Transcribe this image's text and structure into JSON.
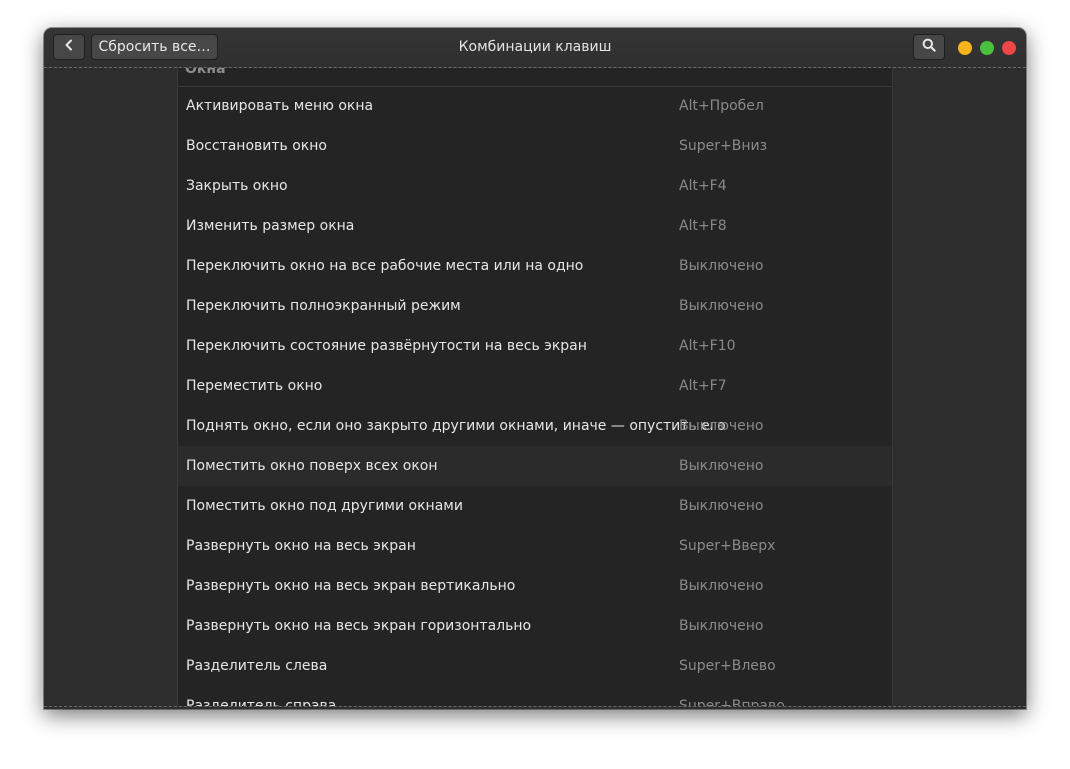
{
  "window": {
    "title": "Комбинации клавиш",
    "reset_label": "Сбросить все…"
  },
  "icons": {
    "back": "chevron-left-icon",
    "search": "search-icon",
    "minimize": "minimize-dot",
    "maximize": "maximize-dot",
    "close": "close-dot"
  },
  "colors": {
    "minimize": "#f5b41c",
    "maximize": "#4ac13e",
    "close": "#ed4646"
  },
  "section": {
    "title": "Окна",
    "rows": [
      {
        "label": "Активировать меню окна",
        "accel": "Alt+Пробел"
      },
      {
        "label": "Восстановить окно",
        "accel": "Super+Вниз"
      },
      {
        "label": "Закрыть окно",
        "accel": "Alt+F4"
      },
      {
        "label": "Изменить размер окна",
        "accel": "Alt+F8"
      },
      {
        "label": "Переключить окно на все рабочие места или на одно",
        "accel": "Выключено"
      },
      {
        "label": "Переключить полноэкранный режим",
        "accel": "Выключено"
      },
      {
        "label": "Переключить состояние развёрнутости на весь экран",
        "accel": "Alt+F10"
      },
      {
        "label": "Переместить окно",
        "accel": "Alt+F7"
      },
      {
        "label": "Поднять окно, если оно закрыто другими окнами, иначе — опустить его",
        "accel": "Выключено"
      },
      {
        "label": "Поместить окно поверх всех окон",
        "accel": "Выключено"
      },
      {
        "label": "Поместить окно под другими окнами",
        "accel": "Выключено"
      },
      {
        "label": "Развернуть окно на весь экран",
        "accel": "Super+Вверх"
      },
      {
        "label": "Развернуть окно на весь экран вертикально",
        "accel": "Выключено"
      },
      {
        "label": "Развернуть окно на весь экран горизонтально",
        "accel": "Выключено"
      },
      {
        "label": "Разделитель слева",
        "accel": "Super+Влево"
      },
      {
        "label": "Разделитель справа",
        "accel": "Super+Вправо"
      }
    ]
  }
}
